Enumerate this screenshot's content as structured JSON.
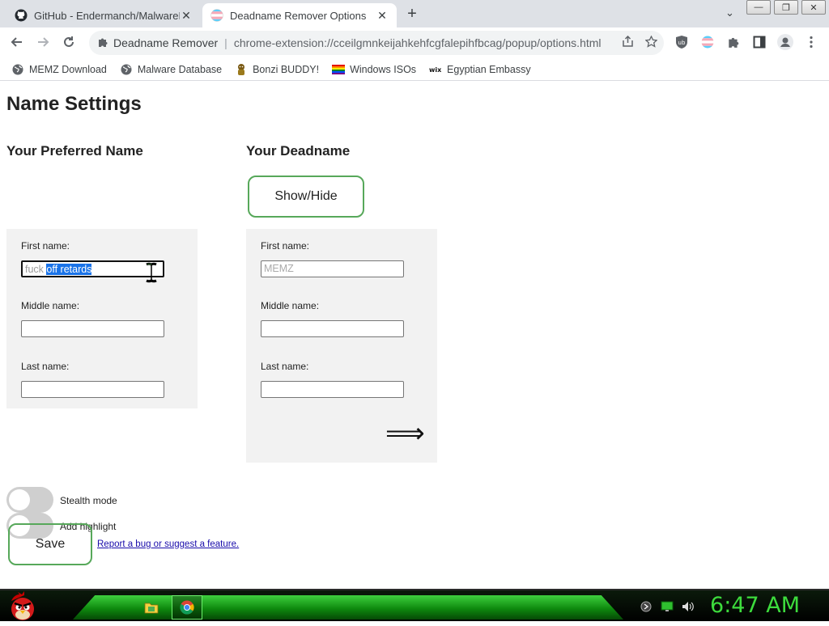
{
  "browser": {
    "tabs": [
      {
        "title": "GitHub - Endermanch/MalwareD",
        "icon": "github-icon",
        "active": false
      },
      {
        "title": "Deadname Remover Options",
        "icon": "trans-flag-icon",
        "active": true
      }
    ],
    "close_glyph": "✕",
    "new_tab_glyph": "+",
    "tab_search_glyph": "⌄",
    "window_buttons": [
      "—",
      "❐",
      "✕"
    ],
    "omnibox": {
      "extension_name": "Deadname Remover",
      "separator": "|",
      "url": "chrome-extension://cceilgmnkeijahkehfcgfalepihfbcag/popup/options.html"
    },
    "bookmarks": [
      {
        "label": "MEMZ Download",
        "icon": "globe-icon"
      },
      {
        "label": "Malware Database",
        "icon": "globe-icon"
      },
      {
        "label": "Bonzi BUDDY!",
        "icon": "bonzi-icon"
      },
      {
        "label": "Windows ISOs",
        "icon": "rainbow-flag-icon"
      },
      {
        "label": "Egyptian Embassy",
        "icon": "wix-icon"
      }
    ]
  },
  "page": {
    "title": "Name Settings",
    "preferred": {
      "heading": "Your Preferred Name",
      "first_label": "First name:",
      "first_value_unselected": "fuck ",
      "first_value_selected": "off retards",
      "middle_label": "Middle name:",
      "middle_value": "",
      "last_label": "Last name:",
      "last_value": ""
    },
    "deadname": {
      "heading": "Your Deadname",
      "show_hide_label": "Show/Hide",
      "first_label": "First name:",
      "first_value": "MEMZ",
      "middle_label": "Middle name:",
      "middle_value": "",
      "last_label": "Last name:",
      "last_value": "",
      "arrow_glyph": "⟹"
    },
    "toggles": [
      {
        "label": "Stealth mode",
        "on": false
      },
      {
        "label": "Add highlight",
        "on": false
      }
    ],
    "save_label": "Save",
    "report_link": "Report a bug or suggest a feature."
  },
  "taskbar": {
    "clock": "6:47 AM",
    "start_icon": "angry-bird-icon",
    "apps": [
      "folder-icon",
      "chrome-icon"
    ]
  },
  "colors": {
    "accent_green": "#57a85a",
    "clock_green": "#3ddc3d",
    "selection_blue": "#1a73e8"
  }
}
